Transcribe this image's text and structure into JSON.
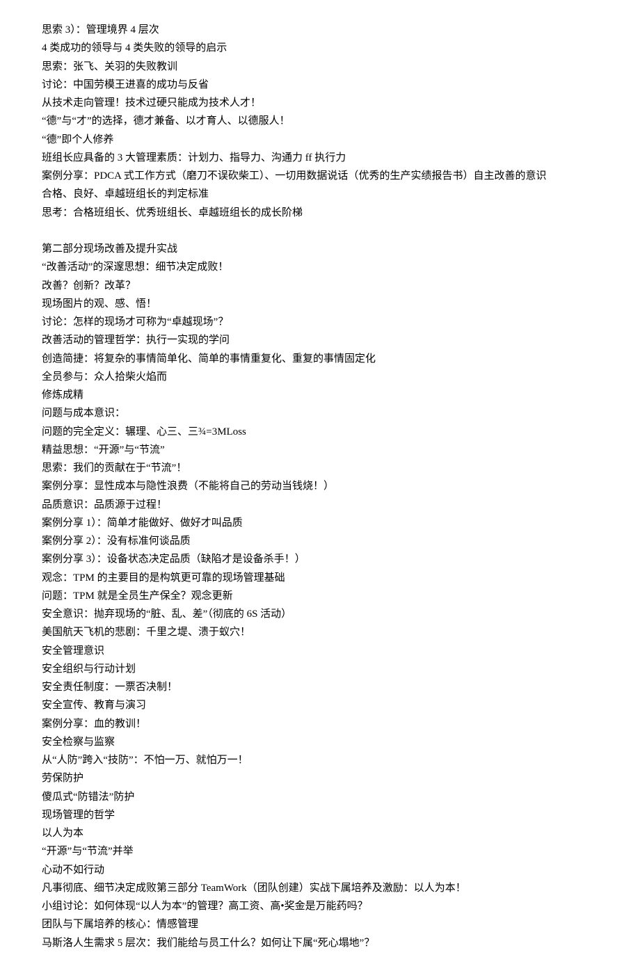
{
  "lines": [
    "思索 3）：管理境界 4 层次",
    "4 类成功的领导与 4 类失败的领导的启示",
    "思索：张飞、关羽的失败教训",
    "讨论：中国劳模王进喜的成功与反省",
    "从技术走向管理！技术过硬只能成为技术人才！",
    "“德”与“才”的选择，德才兼备、以才育人、以德服人！",
    "“德”即个人修养",
    "班组长应具备的 3 大管理素质：计划力、指导力、沟通力 ff 执行力",
    "案例分享：PDCA 式工作方式（磨刀不误砍柴工）、一切用数据说话（优秀的生产实绩报告书）自主改善的意识",
    "合格、良好、卓越班组长的判定标准",
    "思考：合格班组长、优秀班组长、卓越班组长的成长阶梯",
    "",
    "第二部分现场改善及提升实战",
    "“改善活动”的深邃思想：细节决定成败！",
    "改善？创新？改革？",
    "现场图片的观、感、悟！",
    "讨论：怎样的现场才可称为“卓越现场”？",
    "改善活动的管理哲学：执行一实现的学问",
    "创造简捷：将复杂的事情简单化、简单的事情重复化、重复的事情固定化",
    "全员参与：众人拾柴火焰而",
    "修炼成精",
    "问题与成本意识：",
    "问题的完全定义：辗理、心三、三¾=3MLoss",
    "精益思想：“开源”与“节流”",
    "思索：我们的贡献在于“节流”！",
    "案例分享：显性成本与隐性浪费（不能将自己的劳动当钱烧！）",
    "品质意识：品质源于过程！",
    "案例分享 1）：简单才能做好、做好才叫品质",
    "案例分享 2）：没有标准何谈品质",
    "案例分享 3）：设备状态决定品质（缺陷才是设备杀手！）",
    "观念：TPM 的主要目的是构筑更可靠的现场管理基础",
    "问题：TPM 就是全员生产保全？观念更新",
    "安全意识：抛弃现场的“脏、乱、差”（彻底的 6S 活动）",
    "美国航天飞机的悲剧：千里之堤、溃于蚁穴！",
    "安全管理意识",
    "安全组织与行动计划",
    "安全责任制度：一票否决制！",
    "安全宣传、教育与演习",
    "案例分享：血的教训！",
    "安全检察与监察",
    "从“人防”跨入“技防”：不怕一万、就怕万一！",
    "劳保防护",
    "傻瓜式“防错法”防护",
    "现场管理的哲学",
    "以人为本",
    "“开源”与“节流”并举",
    "心动不如行动",
    "凡事彻底、细节决定成败第三部分 TeamWork（团队创建）实战下属培养及激励：以人为本！",
    "小组讨论：如何体现“以人为本”的管理？高工资、高•奖金是万能药吗？",
    "团队与下属培养的核心：情感管理",
    "马斯洛人生需求 5 层次：我们能给与员工什么？如何让下属“死心塌地”？"
  ]
}
